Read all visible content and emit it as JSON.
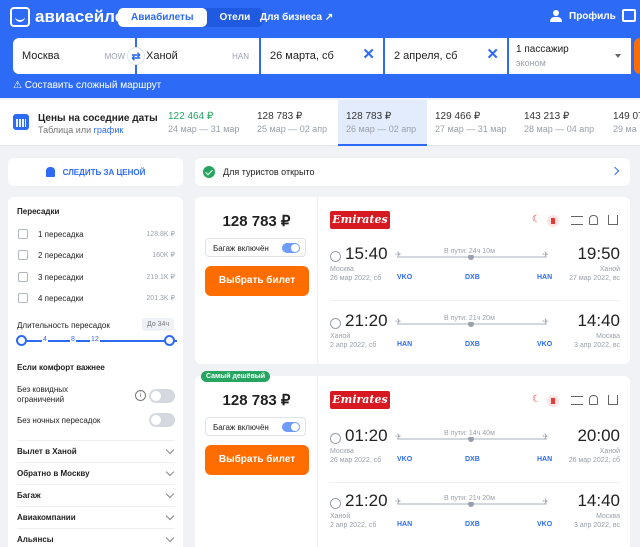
{
  "header": {
    "logo_text": "авиасейлс",
    "tabs": [
      {
        "label": "Авиабилеты",
        "active": true
      },
      {
        "label": "Отели",
        "active": false
      }
    ],
    "business_link": "Для бизнеса ↗",
    "profile_label": "Профиль",
    "accent_color": "#2d6bf6"
  },
  "search": {
    "from_city": "Москва",
    "from_code": "MOW",
    "to_city": "Ханой",
    "to_code": "HAN",
    "depart_date": "26 марта, сб",
    "return_date": "2 апреля, сб",
    "passengers": "1 пассажир",
    "cabin_class": "эконом",
    "complex_route": "Составить сложный маршрут"
  },
  "nearby_dates": {
    "title": "Цены на соседние даты",
    "subtitle_prefix": "Таблица или",
    "subtitle_link": "график",
    "cells": [
      {
        "price": "122 464 ₽",
        "range": "24 мар — 31 мар",
        "cheapest": true,
        "active": false
      },
      {
        "price": "128 783 ₽",
        "range": "25 мар — 02 апр",
        "cheapest": false,
        "active": false
      },
      {
        "price": "128 783 ₽",
        "range": "26 мар — 02 апр",
        "cheapest": false,
        "active": true
      },
      {
        "price": "129 466 ₽",
        "range": "27 мар — 31 мар",
        "cheapest": false,
        "active": false
      },
      {
        "price": "143 213 ₽",
        "range": "28 мар — 04 апр",
        "cheapest": false,
        "active": false
      },
      {
        "price": "149 07",
        "range": "29 ма",
        "cheapest": false,
        "active": false
      }
    ]
  },
  "sidebar": {
    "subscribe_label": "СЛЕДИТЬ ЗА ЦЕНОЙ",
    "transfers_title": "Пересадки",
    "transfers": [
      {
        "label": "1 пересадка",
        "price": "128.8K ₽"
      },
      {
        "label": "2 пересадки",
        "price": "160K ₽"
      },
      {
        "label": "3 пересадки",
        "price": "219.1K ₽"
      },
      {
        "label": "4 пересадки",
        "price": "201.3K ₽"
      }
    ],
    "duration_label": "Длительность пересадок",
    "duration_badge": "До 34ч",
    "slider_ticks": [
      "4",
      "8",
      "12"
    ],
    "comfort_title": "Если комфорт важнее",
    "comfort_options": [
      {
        "label": "Без ковидных ограничений",
        "has_info": true
      },
      {
        "label": "Без ночных пересадок",
        "has_info": false
      }
    ],
    "accordions": [
      "Вылет в Ханой",
      "Обратно в Москву",
      "Багаж",
      "Авиакомпании",
      "Альянсы"
    ]
  },
  "banner": {
    "text": "Для туристов открыто"
  },
  "tickets": [
    {
      "price": "128 783 ₽",
      "baggage_label": "Багаж включён",
      "buy_label": "Выбрать билет",
      "airline": "Emirates",
      "badge": "",
      "segments": [
        {
          "dep_time": "15:40",
          "dep_city": "Москва",
          "dep_date": "26 мар 2022, сб",
          "arr_time": "19:50",
          "arr_city": "Ханой",
          "arr_date": "27 мар 2022, вс",
          "duration": "В пути: 24ч 10м",
          "codes": [
            "VKO",
            "DXB",
            "HAN"
          ]
        },
        {
          "dep_time": "21:20",
          "dep_city": "Ханой",
          "dep_date": "2 апр 2022, сб",
          "arr_time": "14:40",
          "arr_city": "Москва",
          "arr_date": "3 апр 2022, вс",
          "duration": "В пути: 21ч 20м",
          "codes": [
            "HAN",
            "DXB",
            "VKO"
          ]
        }
      ]
    },
    {
      "price": "128 783 ₽",
      "baggage_label": "Багаж включён",
      "buy_label": "Выбрать билет",
      "airline": "Emirates",
      "badge": "Самый дешёвый",
      "segments": [
        {
          "dep_time": "01:20",
          "dep_city": "Москва",
          "dep_date": "26 мар 2022, сб",
          "arr_time": "20:00",
          "arr_city": "Ханой",
          "arr_date": "26 мар 2022, сб",
          "duration": "В пути: 14ч 40м",
          "codes": [
            "VKO",
            "DXB",
            "HAN"
          ]
        },
        {
          "dep_time": "21:20",
          "dep_city": "Ханой",
          "dep_date": "2 апр 2022, сб",
          "arr_time": "14:40",
          "arr_city": "Москва",
          "arr_date": "3 апр 2022, вс",
          "duration": "В пути: 21ч 20м",
          "codes": [
            "HAN",
            "DXB",
            "VKO"
          ]
        }
      ]
    }
  ]
}
